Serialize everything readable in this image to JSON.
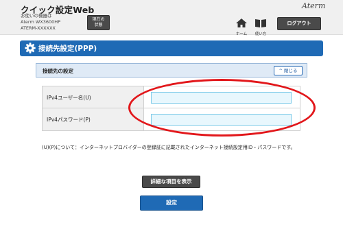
{
  "header": {
    "app_title": "クイック設定Web",
    "device_lines": [
      "お使いの機器は",
      "Aterm WX3600HP",
      "ATERM-XXXXXX"
    ],
    "status_button_lines": [
      "現在の",
      "状態"
    ],
    "brand_logo": "Aterm",
    "home_label": "ホーム",
    "manual_label": "使い方",
    "logout_label": "ログアウト"
  },
  "section": {
    "title": "接続先設定(PPP)"
  },
  "subsection": {
    "title": "接続先の設定",
    "collapse_label": "閉じる"
  },
  "form": {
    "fields": [
      {
        "label": "IPv4ユーザー名(U)",
        "value": "",
        "placeholder": ""
      },
      {
        "label": "IPv4パスワード(P)",
        "value": "",
        "placeholder": ""
      }
    ]
  },
  "note": {
    "text": "(U)(P)について：インターネットプロバイダーの登録証に記載されたインターネット接続設定用ID・パスワードです。"
  },
  "buttons": {
    "details_label": "詳細な項目を表示",
    "submit_label": "設定"
  },
  "colors": {
    "accent_blue": "#1f6ab5",
    "dark_button": "#4a4a4a",
    "highlight_oval": "#e2171b",
    "input_background": "#e8f7fd"
  },
  "icons": {
    "section": "gear-icon",
    "home": "home-icon",
    "manual": "book-icon",
    "collapse": "chevron-up-icon"
  }
}
